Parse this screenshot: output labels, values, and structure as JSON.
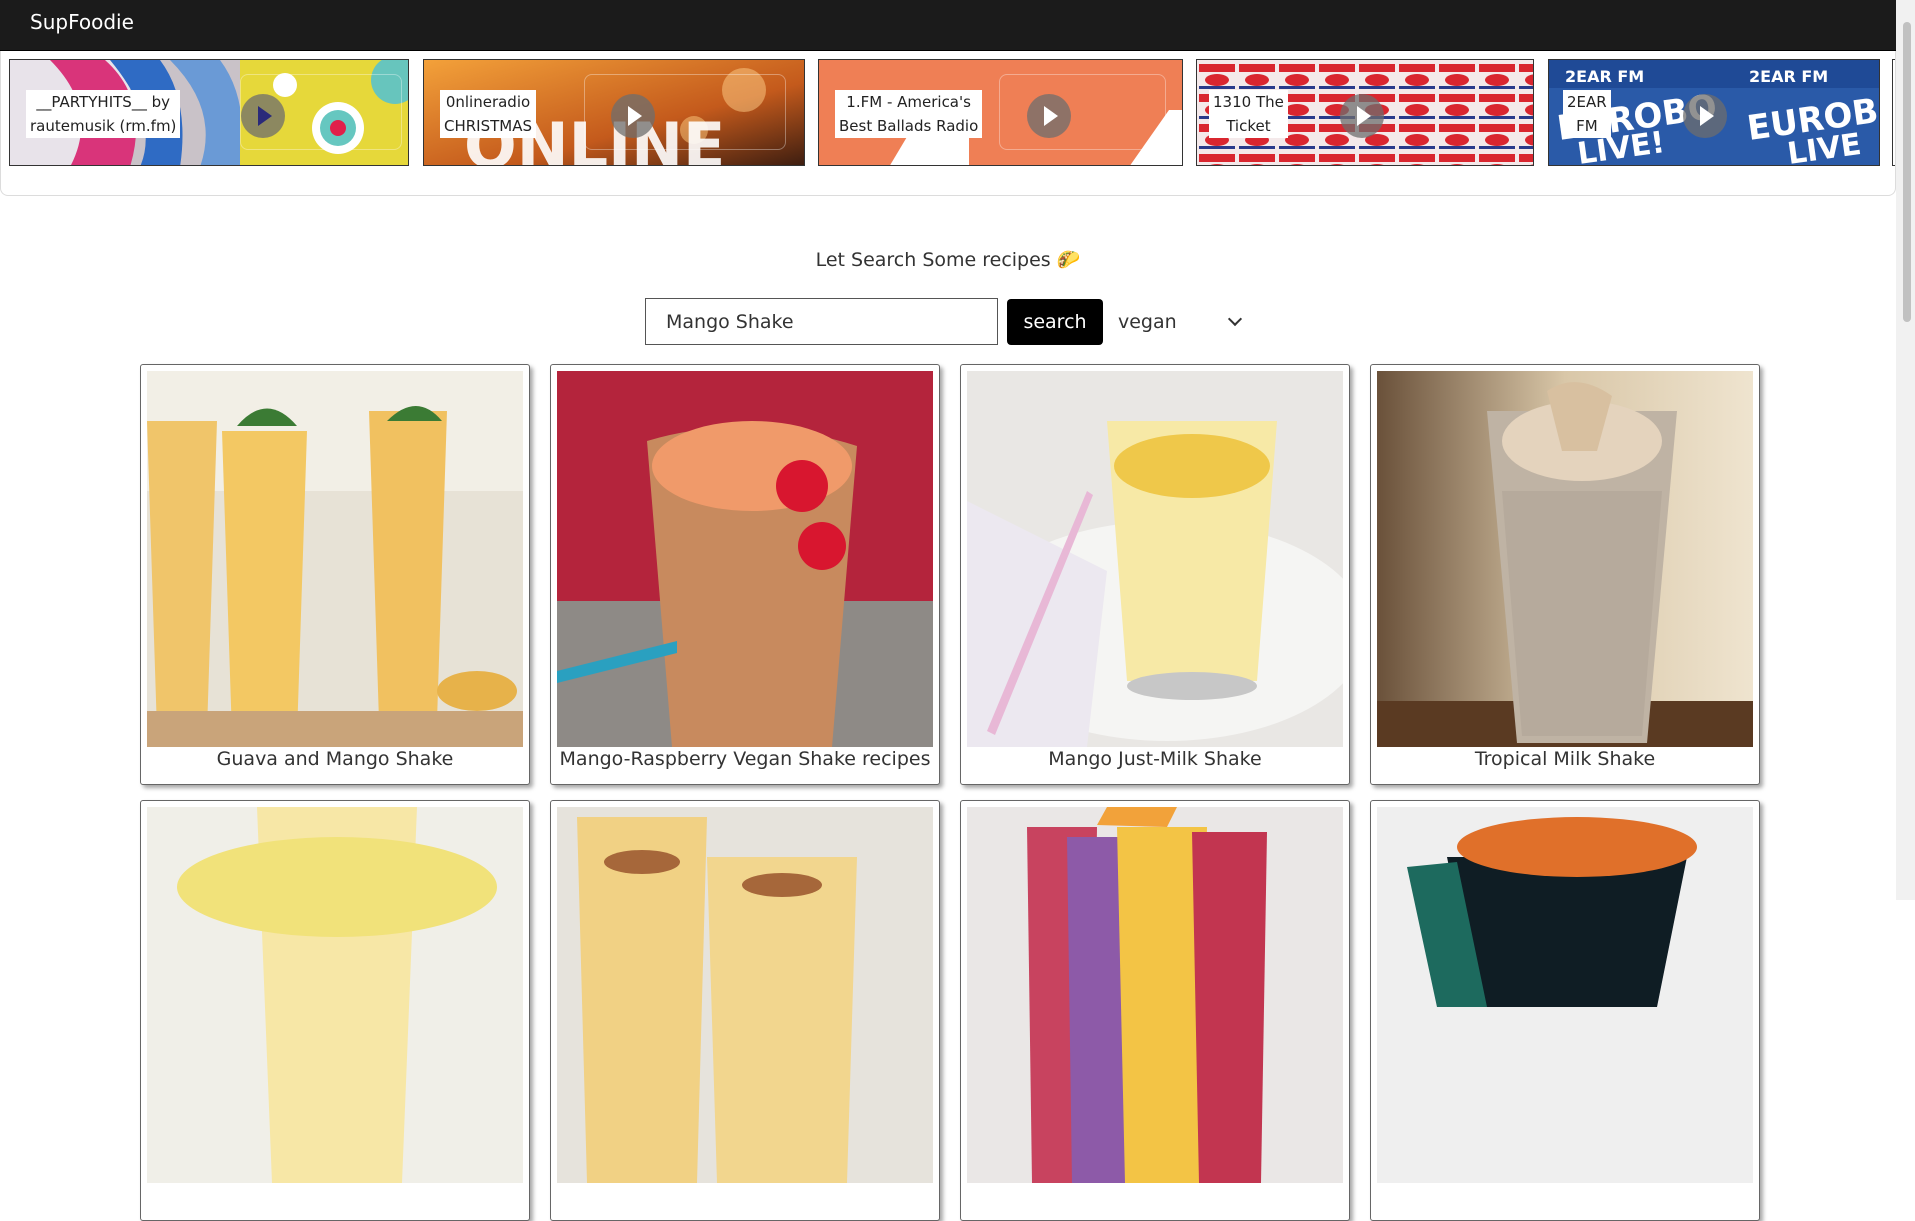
{
  "navbar": {
    "brand": "SupFoodie"
  },
  "radio": {
    "stations": [
      {
        "name": "__PARTYHITS__ by rautemusik (rm.fm)",
        "line1": "__PARTYHITS__ by",
        "line2": "rautemusik (rm.fm)"
      },
      {
        "name": "0nlineradio CHRISTMAS",
        "line1": "0nlineradio",
        "line2": "CHRISTMAS"
      },
      {
        "name": "1.FM - America's Best Ballads Radio",
        "line1": "1.FM - America's",
        "line2": "Best Ballads Radio"
      },
      {
        "name": "1310 The Ticket",
        "line1": "1310 The",
        "line2": "Ticket"
      },
      {
        "name": "2EAR FM",
        "line1": "2EAR",
        "line2": "FM"
      }
    ],
    "play_icon": "play-icon"
  },
  "search": {
    "prompt": "Let Search Some recipes 🌮",
    "query": "Mango Shake",
    "button_label": "search",
    "diet_selected": "vegan"
  },
  "recipes": [
    {
      "title": "Guava and Mango Shake"
    },
    {
      "title": "Mango-Raspberry Vegan Shake recipes"
    },
    {
      "title": "Mango Just-Milk Shake"
    },
    {
      "title": "Tropical Milk Shake"
    },
    {
      "title": ""
    },
    {
      "title": ""
    },
    {
      "title": ""
    },
    {
      "title": ""
    }
  ]
}
